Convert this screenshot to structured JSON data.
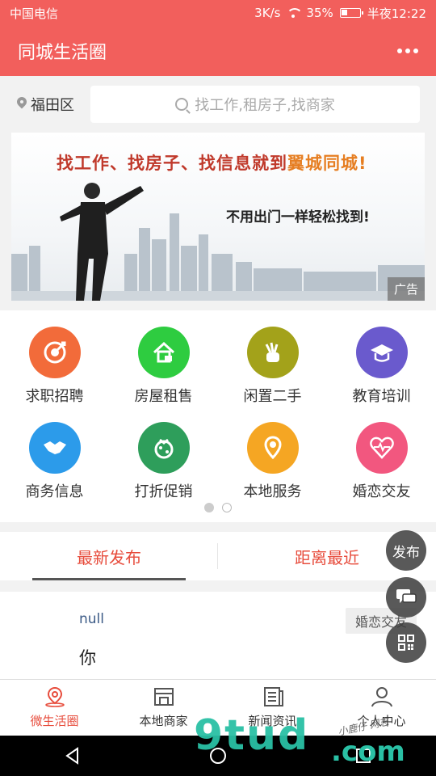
{
  "status": {
    "carrier": "中国电信",
    "speed": "3K/s",
    "battery": "35%",
    "battery_level": 0.35,
    "time": "半夜12:22"
  },
  "header": {
    "title": "同城生活圈",
    "more_icon": "more-dots-icon"
  },
  "search": {
    "location": "福田区",
    "placeholder": "找工作,租房子,找商家"
  },
  "banner": {
    "headline_part1": "找工作、找房子、找信息就到",
    "headline_brand": "翼城同城!",
    "subline": "不用出门一样轻松找到!",
    "ad_label": "广告"
  },
  "categories": [
    {
      "label": "求职招聘",
      "color": "#f26b3a",
      "icon": "target-icon"
    },
    {
      "label": "房屋租售",
      "color": "#2ecc40",
      "icon": "house-icon"
    },
    {
      "label": "闲置二手",
      "color": "#a3a21a",
      "icon": "hand-icon"
    },
    {
      "label": "教育培训",
      "color": "#6a5acd",
      "icon": "graduation-cap-icon"
    },
    {
      "label": "商务信息",
      "color": "#2c9bea",
      "icon": "handshake-icon"
    },
    {
      "label": "打折促销",
      "color": "#2e9e5b",
      "icon": "discount-bag-icon"
    },
    {
      "label": "本地服务",
      "color": "#f5a623",
      "icon": "location-pin-icon"
    },
    {
      "label": "婚恋交友",
      "color": "#f2577f",
      "icon": "heart-pulse-icon"
    }
  ],
  "tabs": [
    {
      "label": "最新发布"
    },
    {
      "label": "距离最近"
    }
  ],
  "post": {
    "user": "null",
    "text": "你",
    "tag": "婚恋交友"
  },
  "fab": {
    "publish": "发布",
    "chat_icon": "chat-icon",
    "qr_icon": "qrcode-icon"
  },
  "bottom_nav": [
    {
      "label": "微生活圈",
      "icon": "location-icon"
    },
    {
      "label": "本地商家",
      "icon": "store-icon"
    },
    {
      "label": "新闻资讯",
      "icon": "news-icon"
    },
    {
      "label": "个人中心",
      "icon": "person-icon"
    }
  ],
  "watermark": {
    "main": "9tud",
    "domain": ".com",
    "note": "小鹿仔 网志"
  }
}
